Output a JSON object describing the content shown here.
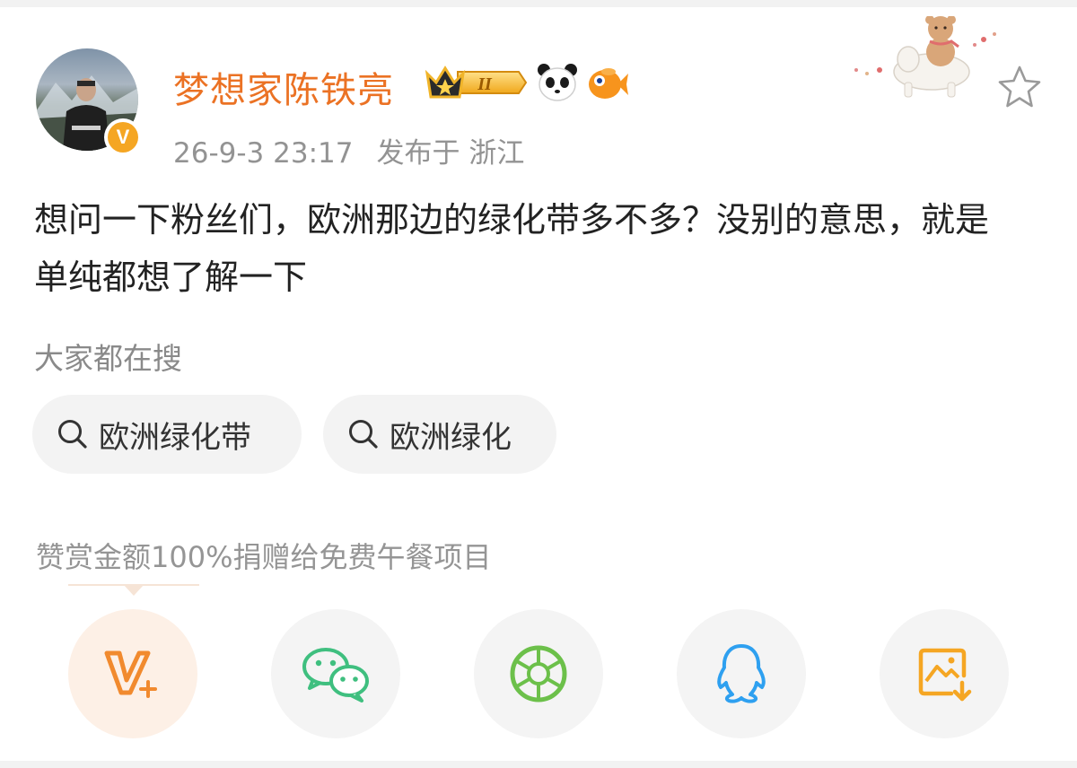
{
  "post": {
    "username": "梦想家陈铁亮",
    "level_badge": "II",
    "verified_mark": "V",
    "timestamp": "26-9-3 23:17",
    "location": "发布于 浙江",
    "text": "想问一下粉丝们，欧洲那边的绿化带多不多？没别的意思，就是单纯都想了解一下"
  },
  "search": {
    "section_label": "大家都在搜",
    "chips": [
      "欧洲绿化带",
      "欧洲绿化"
    ]
  },
  "reward": {
    "donation_text": "赞赏金额100%捐赠给免费午餐项目"
  },
  "icons": {
    "header": [
      "avatar",
      "verified-icon",
      "crown-badge-icon",
      "panda-emoji-icon",
      "fish-emoji-icon",
      "teddy-bear-decoration",
      "star-icon"
    ],
    "share": [
      "v-plus-reward-icon",
      "wechat-icon",
      "moments-icon",
      "qq-icon",
      "save-image-icon"
    ]
  },
  "colors": {
    "username": "#eb7224",
    "accent_orange": "#f18a2e",
    "wechat_green": "#3fbf7f",
    "moments_green": "#6cc04a",
    "qq_blue": "#2ea0f0",
    "save_orange": "#f5a623"
  }
}
